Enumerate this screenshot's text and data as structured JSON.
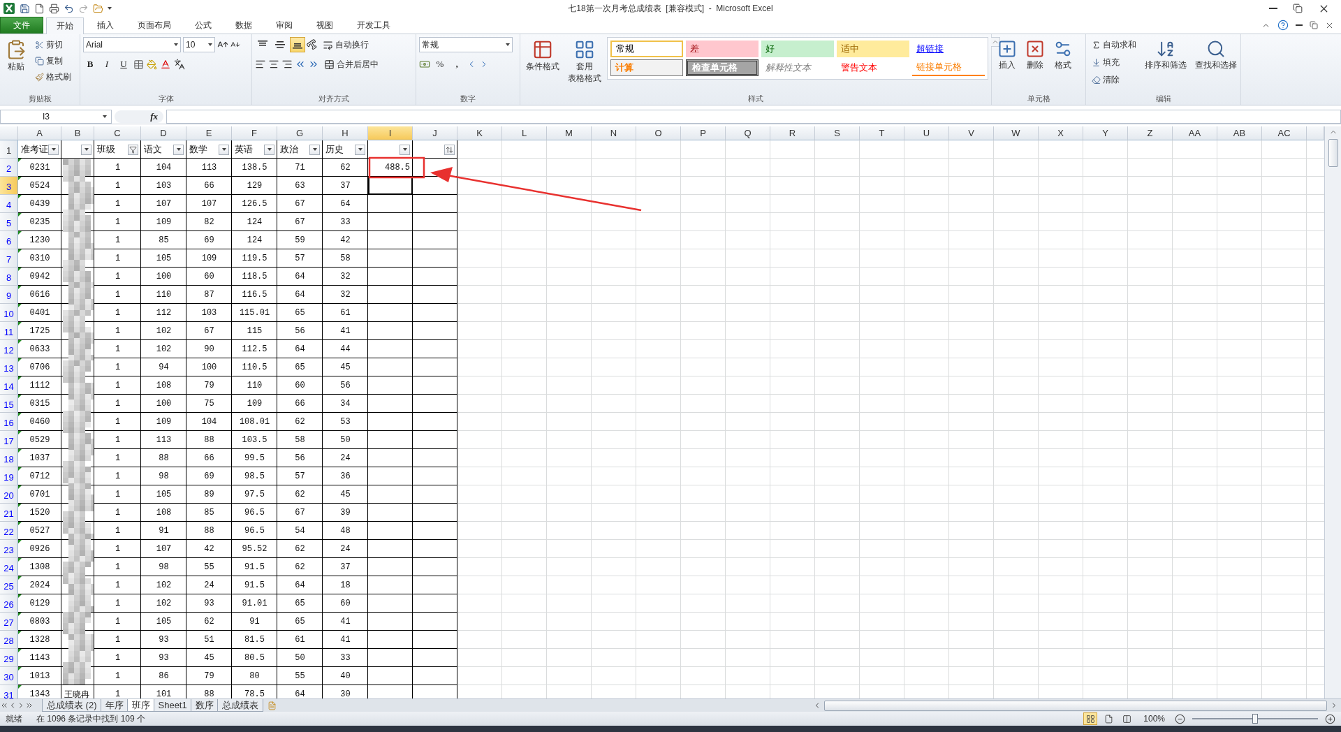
{
  "window": {
    "title": "七18第一次月考总成绩表  [兼容模式]  -  Microsoft Excel"
  },
  "ribbon": {
    "tabs": [
      {
        "label": "文件",
        "kind": "file",
        "selected": false
      },
      {
        "label": "开始",
        "kind": "tab",
        "selected": true
      },
      {
        "label": "插入",
        "kind": "tab",
        "selected": false
      },
      {
        "label": "页面布局",
        "kind": "tab",
        "selected": false
      },
      {
        "label": "公式",
        "kind": "tab",
        "selected": false
      },
      {
        "label": "数据",
        "kind": "tab",
        "selected": false
      },
      {
        "label": "审阅",
        "kind": "tab",
        "selected": false
      },
      {
        "label": "视图",
        "kind": "tab",
        "selected": false
      },
      {
        "label": "开发工具",
        "kind": "tab",
        "selected": false
      }
    ],
    "clipboard": {
      "label": "剪贴板",
      "paste": "粘贴",
      "cut": "剪切",
      "copy": "复制",
      "painter": "格式刷"
    },
    "font": {
      "label": "字体",
      "name": "Arial",
      "size": "10",
      "bold": "B",
      "italic": "I",
      "underline": "U"
    },
    "alignment": {
      "label": "对齐方式",
      "vertical": [
        {
          "selected": false
        },
        {
          "selected": false
        },
        {
          "selected": true
        }
      ],
      "wrap": "自动换行",
      "merge": "合并后居中"
    },
    "number": {
      "label": "数字",
      "format": "常规",
      "percent": "%",
      "comma": ","
    },
    "styles": {
      "label": "样式",
      "conditional": "条件格式",
      "table_format": [
        "套用",
        "表格格式"
      ],
      "cells": [
        {
          "label": "常规",
          "kind": "normal"
        },
        {
          "label": "差",
          "kind": "bad"
        },
        {
          "label": "好",
          "kind": "good"
        },
        {
          "label": "适中",
          "kind": "neutral"
        },
        {
          "label": "超链接",
          "kind": "hyperlink"
        },
        {
          "label": "计算",
          "kind": "calculation"
        },
        {
          "label": "检查单元格",
          "kind": "check"
        },
        {
          "label": "解释性文本",
          "kind": "explanatory"
        },
        {
          "label": "警告文本",
          "kind": "warning"
        },
        {
          "label": "链接单元格",
          "kind": "linked"
        }
      ]
    },
    "cells": {
      "label": "单元格",
      "buttons": [
        "插入",
        "删除",
        "格式"
      ]
    },
    "editing": {
      "label": "编辑",
      "autosum": "自动求和",
      "fill": "填充",
      "clear": "清除",
      "sort": "排序和筛选",
      "find": "查找和选择"
    }
  },
  "formula_bar": {
    "name_box": "I3",
    "function_label": "fx"
  },
  "grid": {
    "columns": [
      {
        "label": "A",
        "selected": false
      },
      {
        "label": "B",
        "selected": false
      },
      {
        "label": "C",
        "selected": false
      },
      {
        "label": "D",
        "selected": false
      },
      {
        "label": "E",
        "selected": false
      },
      {
        "label": "F",
        "selected": false
      },
      {
        "label": "G",
        "selected": false
      },
      {
        "label": "H",
        "selected": false
      },
      {
        "label": "I",
        "selected": true
      },
      {
        "label": "J",
        "selected": false
      },
      {
        "label": "K",
        "selected": false
      },
      {
        "label": "L",
        "selected": false
      },
      {
        "label": "M",
        "selected": false
      },
      {
        "label": "N",
        "selected": false
      },
      {
        "label": "O",
        "selected": false
      },
      {
        "label": "P",
        "selected": false
      },
      {
        "label": "Q",
        "selected": false
      },
      {
        "label": "R",
        "selected": false
      },
      {
        "label": "S",
        "selected": false
      },
      {
        "label": "T",
        "selected": false
      },
      {
        "label": "U",
        "selected": false
      },
      {
        "label": "V",
        "selected": false
      },
      {
        "label": "W",
        "selected": false
      },
      {
        "label": "X",
        "selected": false
      },
      {
        "label": "Y",
        "selected": false
      },
      {
        "label": "Z",
        "selected": false
      },
      {
        "label": "AA",
        "selected": false
      },
      {
        "label": "AB",
        "selected": false
      },
      {
        "label": "AC",
        "selected": false
      }
    ],
    "header_row": {
      "number": "1",
      "cells": [
        {
          "text": "准考证",
          "filtered": false,
          "sorted": false
        },
        {
          "filtered": false,
          "sorted": false
        },
        {
          "text": "班级",
          "filtered": true,
          "sorted": false
        },
        {
          "text": "语文",
          "filtered": false,
          "sorted": false
        },
        {
          "text": "数学",
          "filtered": false,
          "sorted": false
        },
        {
          "text": "英语",
          "filtered": false,
          "sorted": false
        },
        {
          "text": "政治",
          "filtered": false,
          "sorted": false
        },
        {
          "text": "历史",
          "filtered": false,
          "sorted": false
        },
        {
          "filtered": false,
          "sorted": false
        },
        {
          "filtered": false,
          "sorted": true
        }
      ]
    },
    "rows_filtered": true,
    "rows": [
      {
        "number": "2",
        "selected": false,
        "id": "0231",
        "class": "1",
        "scores": [
          "104",
          "113",
          "138.5",
          "71",
          "62"
        ],
        "total": "488.5",
        "boxed": true
      },
      {
        "number": "3",
        "selected": true,
        "id": "0524",
        "class": "1",
        "scores": [
          "103",
          "66",
          "129",
          "63",
          "37"
        ]
      },
      {
        "number": "4",
        "selected": false,
        "id": "0439",
        "class": "1",
        "scores": [
          "107",
          "107",
          "126.5",
          "67",
          "64"
        ]
      },
      {
        "number": "5",
        "selected": false,
        "id": "0235",
        "class": "1",
        "scores": [
          "109",
          "82",
          "124",
          "67",
          "33"
        ]
      },
      {
        "number": "6",
        "selected": false,
        "id": "1230",
        "class": "1",
        "scores": [
          "85",
          "69",
          "124",
          "59",
          "42"
        ]
      },
      {
        "number": "7",
        "selected": false,
        "id": "0310",
        "class": "1",
        "scores": [
          "105",
          "109",
          "119.5",
          "57",
          "58"
        ]
      },
      {
        "number": "8",
        "selected": false,
        "id": "0942",
        "class": "1",
        "scores": [
          "100",
          "60",
          "118.5",
          "64",
          "32"
        ]
      },
      {
        "number": "9",
        "selected": false,
        "id": "0616",
        "class": "1",
        "scores": [
          "110",
          "87",
          "116.5",
          "64",
          "32"
        ]
      },
      {
        "number": "10",
        "selected": false,
        "id": "0401",
        "class": "1",
        "scores": [
          "112",
          "103",
          "115.01",
          "65",
          "61"
        ]
      },
      {
        "number": "11",
        "selected": false,
        "id": "1725",
        "class": "1",
        "scores": [
          "102",
          "67",
          "115",
          "56",
          "41"
        ]
      },
      {
        "number": "12",
        "selected": false,
        "id": "0633",
        "class": "1",
        "scores": [
          "102",
          "90",
          "112.5",
          "64",
          "44"
        ]
      },
      {
        "number": "13",
        "selected": false,
        "id": "0706",
        "class": "1",
        "scores": [
          "94",
          "100",
          "110.5",
          "65",
          "45"
        ]
      },
      {
        "number": "14",
        "selected": false,
        "id": "1112",
        "class": "1",
        "scores": [
          "108",
          "79",
          "110",
          "60",
          "56"
        ]
      },
      {
        "number": "15",
        "selected": false,
        "id": "0315",
        "class": "1",
        "scores": [
          "100",
          "75",
          "109",
          "66",
          "34"
        ]
      },
      {
        "number": "16",
        "selected": false,
        "id": "0460",
        "class": "1",
        "scores": [
          "109",
          "104",
          "108.01",
          "62",
          "53"
        ]
      },
      {
        "number": "17",
        "selected": false,
        "id": "0529",
        "class": "1",
        "scores": [
          "113",
          "88",
          "103.5",
          "58",
          "50"
        ]
      },
      {
        "number": "18",
        "selected": false,
        "id": "1037",
        "class": "1",
        "scores": [
          "88",
          "66",
          "99.5",
          "56",
          "24"
        ]
      },
      {
        "number": "19",
        "selected": false,
        "id": "0712",
        "class": "1",
        "scores": [
          "98",
          "69",
          "98.5",
          "57",
          "36"
        ]
      },
      {
        "number": "20",
        "selected": false,
        "id": "0701",
        "class": "1",
        "scores": [
          "105",
          "89",
          "97.5",
          "62",
          "45"
        ]
      },
      {
        "number": "21",
        "selected": false,
        "id": "1520",
        "class": "1",
        "scores": [
          "108",
          "85",
          "96.5",
          "67",
          "39"
        ]
      },
      {
        "number": "22",
        "selected": false,
        "id": "0527",
        "class": "1",
        "scores": [
          "91",
          "88",
          "96.5",
          "54",
          "48"
        ]
      },
      {
        "number": "23",
        "selected": false,
        "id": "0926",
        "class": "1",
        "scores": [
          "107",
          "42",
          "95.52",
          "62",
          "24"
        ]
      },
      {
        "number": "24",
        "selected": false,
        "id": "1308",
        "class": "1",
        "scores": [
          "98",
          "55",
          "91.5",
          "62",
          "37"
        ]
      },
      {
        "number": "25",
        "selected": false,
        "id": "2024",
        "class": "1",
        "scores": [
          "102",
          "24",
          "91.5",
          "64",
          "18"
        ]
      },
      {
        "number": "26",
        "selected": false,
        "id": "0129",
        "class": "1",
        "scores": [
          "102",
          "93",
          "91.01",
          "65",
          "60"
        ]
      },
      {
        "number": "27",
        "selected": false,
        "id": "0803",
        "class": "1",
        "scores": [
          "105",
          "62",
          "91",
          "65",
          "41"
        ]
      },
      {
        "number": "28",
        "selected": false,
        "id": "1328",
        "class": "1",
        "scores": [
          "93",
          "51",
          "81.5",
          "61",
          "41"
        ]
      },
      {
        "number": "29",
        "selected": false,
        "id": "1143",
        "class": "1",
        "scores": [
          "93",
          "45",
          "80.5",
          "50",
          "33"
        ]
      },
      {
        "number": "30",
        "selected": false,
        "id": "1013",
        "class": "1",
        "scores": [
          "86",
          "79",
          "80",
          "55",
          "40"
        ]
      },
      {
        "number": "31",
        "selected": false,
        "id": "1343",
        "name": "王晓冉",
        "class": "1",
        "scores": [
          "101",
          "88",
          "78.5",
          "64",
          "30"
        ]
      }
    ],
    "redaction": {
      "kind": "mosaic"
    },
    "annotations": [
      {
        "kind": "arrow"
      }
    ]
  },
  "sheet_tabs": [
    {
      "label": "总成绩表 (2)",
      "selected": false
    },
    {
      "label": "年序",
      "selected": false
    },
    {
      "label": "班序",
      "selected": true
    },
    {
      "label": "Sheet1",
      "selected": false
    },
    {
      "label": "数序",
      "selected": false
    },
    {
      "label": "总成绩表",
      "selected": false
    }
  ],
  "status_bar": {
    "mode": "就绪",
    "message": "在 1096 条记录中找到 109 个",
    "views": [
      {
        "selected": true
      },
      {
        "selected": false
      },
      {
        "selected": false
      }
    ],
    "zoom": "100%",
    "zoom_slider": {
      "level": 0.5
    }
  }
}
